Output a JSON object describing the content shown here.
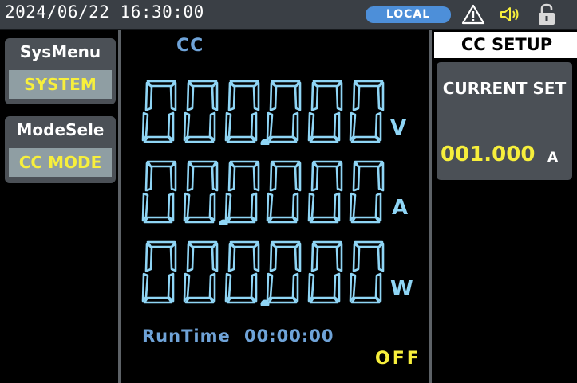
{
  "status_bar": {
    "datetime": "2024/06/22 16:30:00",
    "remote_state": "LOCAL",
    "icons": [
      "warning-icon",
      "speaker-icon",
      "lock-icon"
    ],
    "icon_color_warning": "#ffffff",
    "icon_color_speaker": "#f7ef3c"
  },
  "left_menu": {
    "items": [
      {
        "title": "SysMenu",
        "value": "SYSTEM"
      },
      {
        "title": "ModeSele",
        "value": "CC MODE"
      }
    ]
  },
  "main": {
    "mode": "CC",
    "readings": [
      {
        "digits": "000000",
        "decimal_after": 3,
        "unit": "V"
      },
      {
        "digits": "000000",
        "decimal_after": 2,
        "unit": "A"
      },
      {
        "digits": "000000",
        "decimal_after": 3,
        "unit": "W"
      }
    ],
    "runtime_label": "RunTime",
    "runtime_value": "00:00:00",
    "output_state": "OFF"
  },
  "right_panel": {
    "title": "CC SETUP",
    "setting_label": "CURRENT SET",
    "setting_value": "001.000",
    "setting_unit": "A"
  },
  "colors": {
    "digit_color": "#8fd5f5",
    "label_blue": "#6fa3d8",
    "highlight_yellow": "#f7ef3c",
    "badge_blue": "#4d8fd9",
    "panel_gray": "#4b5056"
  }
}
